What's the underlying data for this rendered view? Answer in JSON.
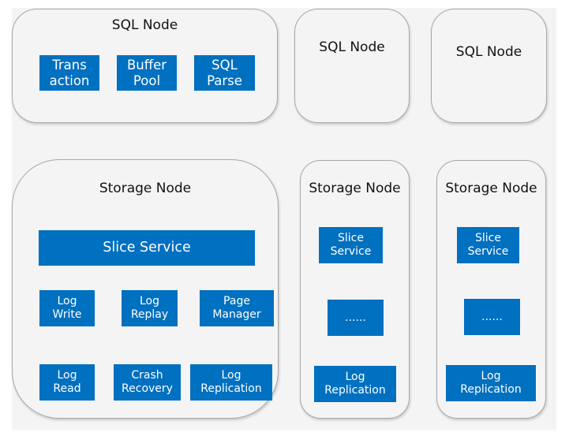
{
  "sql_nodes": [
    {
      "title": "SQL Node",
      "components": [
        "Trans\naction",
        "Buffer\nPool",
        "SQL\nParse"
      ]
    },
    {
      "title": "SQL Node"
    },
    {
      "title": "SQL Node"
    }
  ],
  "storage_nodes": [
    {
      "title": "Storage Node",
      "slice_service": "Slice Service",
      "row1": [
        "Log\nWrite",
        "Log\nReplay",
        "Page\nManager"
      ],
      "row2": [
        "Log\nRead",
        "Crash\nRecovery",
        "Log\nReplication"
      ]
    },
    {
      "title": "Storage Node",
      "slice_service": "Slice\nService",
      "ellipsis": "......",
      "log_replication": "Log\nReplication"
    },
    {
      "title": "Storage Node",
      "slice_service": "Slice\nService",
      "ellipsis": "......",
      "log_replication": "Log\nReplication"
    }
  ],
  "colors": {
    "component": "#0070c0",
    "node_bg": "#f4f4f4",
    "node_border": "#a8a8a8"
  }
}
